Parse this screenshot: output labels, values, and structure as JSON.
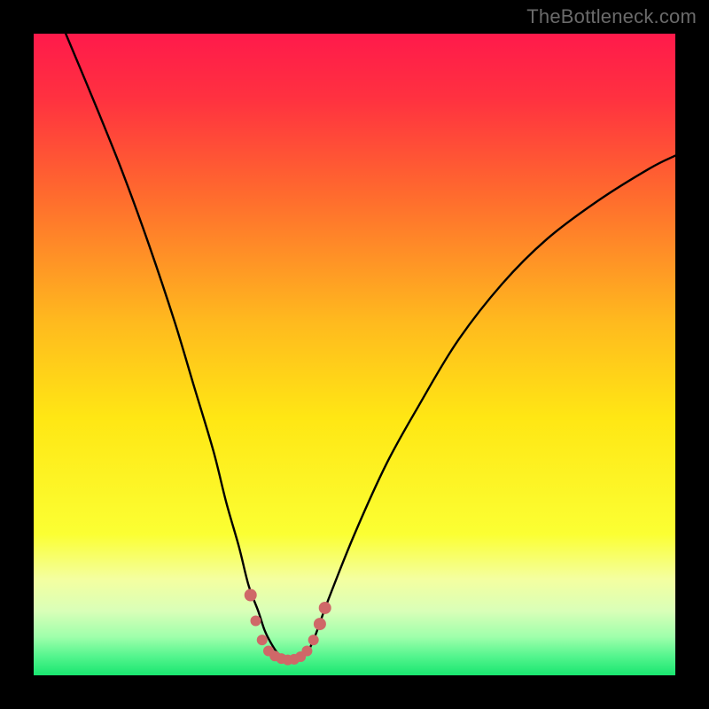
{
  "watermark": "TheBottleneck.com",
  "chart_data": {
    "type": "line",
    "title": "",
    "xlabel": "",
    "ylabel": "",
    "xlim": [
      0,
      100
    ],
    "ylim": [
      0,
      100
    ],
    "background_gradient": {
      "stops": [
        {
          "offset": 0.0,
          "color": "#ff1a4b"
        },
        {
          "offset": 0.1,
          "color": "#ff3140"
        },
        {
          "offset": 0.25,
          "color": "#ff6a2e"
        },
        {
          "offset": 0.45,
          "color": "#ffba1e"
        },
        {
          "offset": 0.6,
          "color": "#ffe714"
        },
        {
          "offset": 0.78,
          "color": "#fbff33"
        },
        {
          "offset": 0.85,
          "color": "#f4ffa0"
        },
        {
          "offset": 0.9,
          "color": "#d9ffb8"
        },
        {
          "offset": 0.94,
          "color": "#9fffab"
        },
        {
          "offset": 0.97,
          "color": "#55f58e"
        },
        {
          "offset": 1.0,
          "color": "#19e670"
        }
      ]
    },
    "series": [
      {
        "name": "bottleneck-curve",
        "color": "#000000",
        "width": 2.4,
        "x": [
          5,
          10,
          14,
          18,
          22,
          25,
          28,
          30,
          32,
          33.5,
          35,
          36,
          37,
          38,
          39,
          40,
          41,
          42,
          43,
          44,
          46,
          50,
          55,
          60,
          66,
          73,
          80,
          88,
          96,
          100
        ],
        "y": [
          100,
          88,
          78,
          67,
          55,
          45,
          35,
          27,
          20,
          14,
          10,
          7,
          5,
          3.5,
          2.8,
          2.4,
          2.5,
          3.0,
          4.2,
          6.5,
          12,
          22,
          33,
          42,
          52,
          61,
          68,
          74,
          79,
          81
        ]
      }
    ],
    "markers": {
      "name": "highlight-band",
      "color": "#cf6868",
      "radius_small": 5,
      "radius_end": 7,
      "points": [
        {
          "x": 33.8,
          "y": 12.5,
          "r": 7
        },
        {
          "x": 34.6,
          "y": 8.5,
          "r": 6
        },
        {
          "x": 35.6,
          "y": 5.5,
          "r": 6
        },
        {
          "x": 36.6,
          "y": 3.8,
          "r": 6
        },
        {
          "x": 37.6,
          "y": 3.0,
          "r": 6
        },
        {
          "x": 38.6,
          "y": 2.6,
          "r": 6
        },
        {
          "x": 39.6,
          "y": 2.4,
          "r": 6
        },
        {
          "x": 40.6,
          "y": 2.5,
          "r": 6
        },
        {
          "x": 41.6,
          "y": 2.9,
          "r": 6
        },
        {
          "x": 42.6,
          "y": 3.8,
          "r": 6
        },
        {
          "x": 43.6,
          "y": 5.5,
          "r": 6
        },
        {
          "x": 44.6,
          "y": 8.0,
          "r": 7
        },
        {
          "x": 45.4,
          "y": 10.5,
          "r": 7
        }
      ]
    }
  }
}
